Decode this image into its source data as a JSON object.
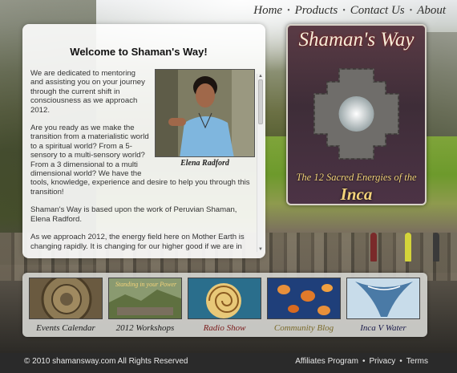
{
  "nav": {
    "items": [
      "Home",
      "Products",
      "Contact Us",
      "About"
    ]
  },
  "welcome": {
    "title": "Welcome to Shaman's Way!",
    "paragraphs": [
      "We are dedicated to mentoring and assisting you on your journey through the current shift in consciousness as we approach 2012.",
      "Are you ready as we make the transition from a materialistic world to a spiritual world? From a 5-sensory to a multi-sensory world? From a 3 dimensional to a multi dimensional world? We have the tools, knowledge, experience and desire to help you through this transition!",
      "Shaman's Way is based upon the work of Peruvian Shaman, Elena Radford.",
      "As we approach 2012, the energy field here on Mother Earth is changing rapidly. It is changing for our higher good if we are in"
    ],
    "photo_caption": "Elena Radford"
  },
  "book": {
    "title": "Shaman's Way",
    "subtitle": "The 12 Sacred Energies of the",
    "subtitle_main": "Inca"
  },
  "thumbnails": [
    {
      "label": "Events Calendar",
      "color": "#1a1a1a"
    },
    {
      "label": "2012 Workshops",
      "color": "#1a1a1a",
      "overlay": "Standing in your Power"
    },
    {
      "label": "Radio Show",
      "color": "#7a1a1a"
    },
    {
      "label": "Community Blog",
      "color": "#7a6a2a"
    },
    {
      "label": "Inca V Water",
      "color": "#1a1a4a"
    }
  ],
  "footer": {
    "copyright": "© 2010 shamansway.com All Rights Reserved",
    "links": [
      "Affiliates Program",
      "Privacy",
      "Terms"
    ]
  },
  "colors": {
    "footer_bg": "#2a2a2a",
    "book_gold": "#f2d27a",
    "panel_bg": "#ffffff"
  }
}
